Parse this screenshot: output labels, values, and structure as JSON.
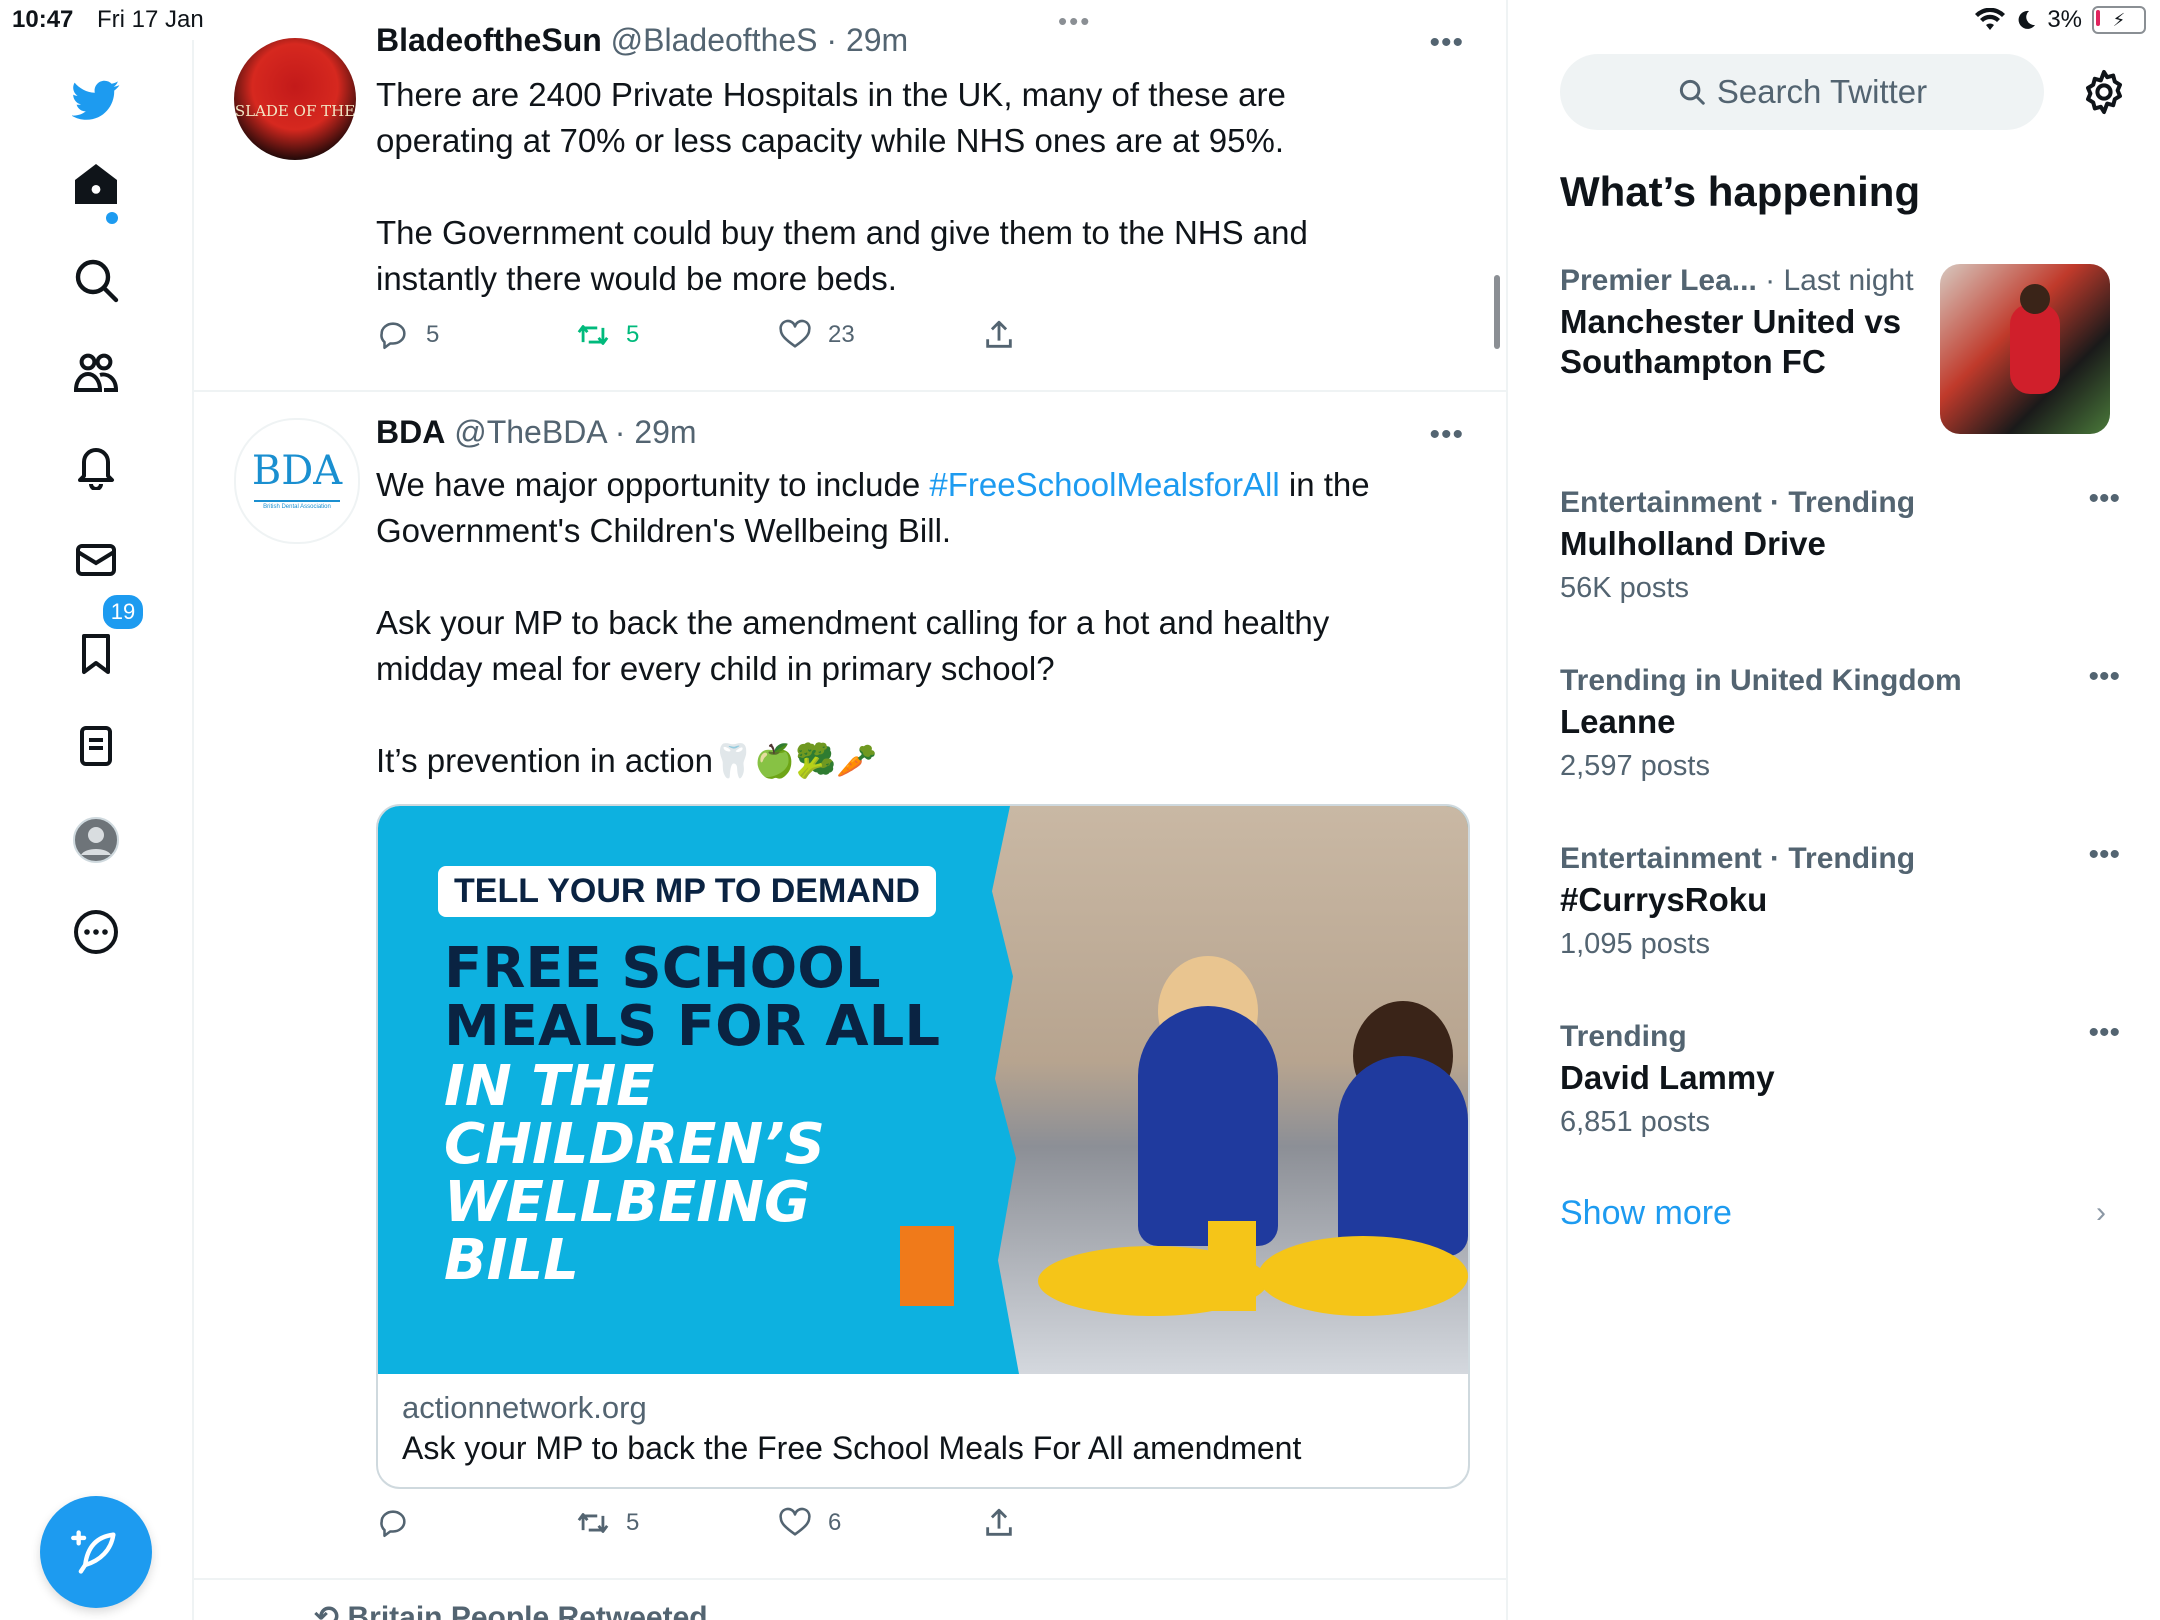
{
  "status_bar": {
    "time": "10:47",
    "date": "Fri 17 Jan",
    "battery": "3%"
  },
  "nav": {
    "items": [
      "twitter-logo",
      "home",
      "explore",
      "communities",
      "notifications",
      "messages",
      "bookmarks",
      "lists",
      "profile",
      "more"
    ],
    "notification_count": "19"
  },
  "tweets": [
    {
      "name": "BladeoftheSun",
      "handle": "@BladeoftheS",
      "time": "· 29m",
      "text": "There are 2400 Private Hospitals in the UK, many of these are\noperating at 70% or less capacity while NHS ones are at 95%.\n\nThe Government could buy them and give them to the NHS and\ninstantly there would be more beds.",
      "avatar_text": "SLADE OF THE",
      "replies": "5",
      "retweets": "5",
      "likes": "23"
    },
    {
      "name": "BDA",
      "handle": "@TheBDA",
      "time": "· 29m",
      "text_before_link": "We have major opportunity to include ",
      "hashtag": "#FreeSchoolMealsforAll",
      "text_after_link": " in the\nGovernment's Children's Wellbeing Bill.\n\nAsk your MP to back the amendment calling for a hot and healthy\nmidday meal for every child in primary school?\n\nIt’s prevention in action🦷🍏🥦🥕",
      "avatar_text": "BDA",
      "avatar_sub": "British Dental Association",
      "card": {
        "pill": "TELL YOUR MP TO DEMAND",
        "headline_1": "FREE SCHOOL\nMEALS FOR ALL",
        "headline_2": "IN THE\nCHILDREN’S\nWELLBEING\nBILL",
        "domain": "actionnetwork.org",
        "title": "Ask your MP to back the Free School Meals For All amendment"
      },
      "replies": "",
      "retweets": "5",
      "likes": "6"
    }
  ],
  "next_tweet_label": "Britain People Retweeted",
  "sidebar": {
    "search_placeholder": "Search Twitter",
    "heading": "What’s happening",
    "trends": [
      {
        "context": "Premier Lea...",
        "time": "· Last night",
        "name": "Manchester United vs\nSouthampton FC",
        "count": ""
      },
      {
        "context": "Entertainment · Trending",
        "name": "Mulholland Drive",
        "count": "56K posts"
      },
      {
        "context": "Trending in United Kingdom",
        "name": "Leanne",
        "count": "2,597 posts"
      },
      {
        "context": "Entertainment · Trending",
        "name": "#CurrysRoku",
        "count": "1,095 posts"
      },
      {
        "context": "Trending",
        "name": "David Lammy",
        "count": "6,851 posts"
      }
    ],
    "show_more": "Show more"
  },
  "colors": {
    "accent": "#1d9bf0",
    "retweet_green": "#00ba7c",
    "card_blue": "#0db1e0"
  }
}
